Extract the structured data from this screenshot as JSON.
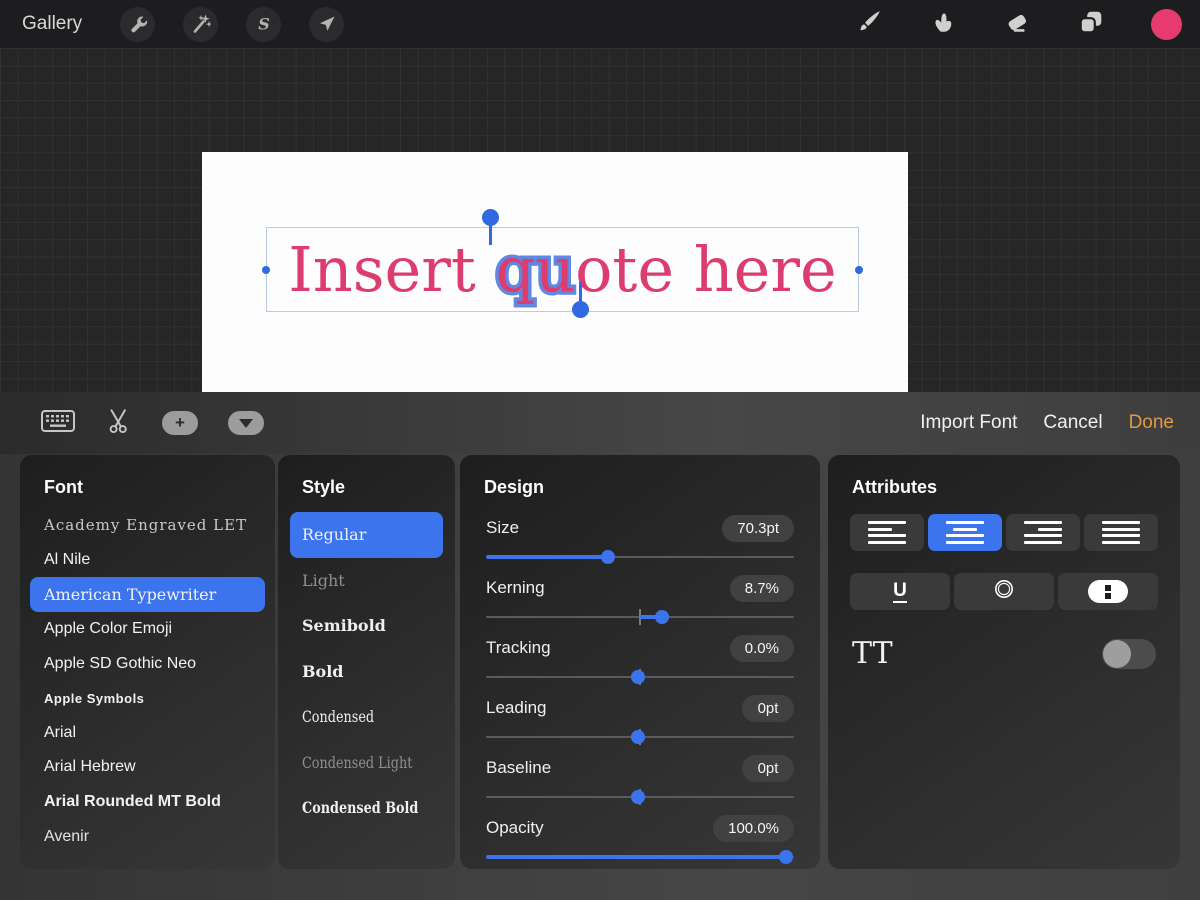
{
  "accent_color": "#3B74EC",
  "topbar": {
    "gallery_label": "Gallery",
    "left_tools": [
      "actions-wrench",
      "adjustments-wand",
      "selection-s",
      "transform-arrow"
    ],
    "right_tools": [
      "brush",
      "smudge",
      "eraser",
      "layers"
    ],
    "color_swatch_color": "#E73B6F"
  },
  "canvas": {
    "text_before": "Insert ",
    "text_selected": "qu",
    "text_after": "ote here",
    "text_color": "#DC3C6E",
    "selection_outline_color": "#6287E0"
  },
  "text_toolbar": {
    "left_tools": [
      "keyboard",
      "scissors",
      "add",
      "collapse"
    ],
    "import_font_label": "Import Font",
    "cancel_label": "Cancel",
    "done_label": "Done",
    "done_color": "#E09A40"
  },
  "font_panel": {
    "title": "Font",
    "items": [
      {
        "label": "Academy Engraved LET",
        "style": "engraved",
        "selected": false
      },
      {
        "label": "Al Nile",
        "style": "sans",
        "selected": false
      },
      {
        "label": "American Typewriter",
        "style": "typewriter",
        "selected": true
      },
      {
        "label": "Apple Color Emoji",
        "style": "sans",
        "selected": false
      },
      {
        "label": "Apple SD Gothic Neo",
        "style": "sans",
        "selected": false
      },
      {
        "label": "Apple Symbols",
        "style": "sans-sm",
        "selected": false
      },
      {
        "label": "Arial",
        "style": "sans",
        "selected": false
      },
      {
        "label": "Arial Hebrew",
        "style": "sans",
        "selected": false
      },
      {
        "label": "Arial Rounded MT Bold",
        "style": "sans-bold",
        "selected": false
      },
      {
        "label": "Avenir",
        "style": "avenir",
        "selected": false
      }
    ]
  },
  "style_panel": {
    "title": "Style",
    "items": [
      {
        "label": "Regular",
        "style": "regular",
        "selected": true
      },
      {
        "label": "Light",
        "style": "light",
        "selected": false
      },
      {
        "label": "Semibold",
        "style": "semibold",
        "selected": false
      },
      {
        "label": "Bold",
        "style": "bold",
        "selected": false
      },
      {
        "label": "Condensed",
        "style": "cond",
        "selected": false
      },
      {
        "label": "Condensed Light",
        "style": "cond-light",
        "selected": false
      },
      {
        "label": "Condensed Bold",
        "style": "cond-bold",
        "selected": false
      }
    ]
  },
  "design_panel": {
    "title": "Design",
    "rows": [
      {
        "label": "Size",
        "value": "70.3pt",
        "knob": 0.397,
        "fill_from": 0,
        "center_tick": false
      },
      {
        "label": "Kerning",
        "value": "8.7%",
        "knob": 0.57,
        "fill_from": 0.5,
        "center_tick": true
      },
      {
        "label": "Tracking",
        "value": "0.0%",
        "knob": 0.495,
        "fill_from": null,
        "center_tick": true
      },
      {
        "label": "Leading",
        "value": "0pt",
        "knob": 0.495,
        "fill_from": null,
        "center_tick": true
      },
      {
        "label": "Baseline",
        "value": "0pt",
        "knob": 0.495,
        "fill_from": null,
        "center_tick": true
      },
      {
        "label": "Opacity",
        "value": "100.0%",
        "knob": 0.973,
        "fill_from": 0,
        "center_tick": false
      }
    ]
  },
  "attributes_panel": {
    "title": "Attributes",
    "alignment_options": [
      "align-left",
      "align-center",
      "align-right",
      "justify"
    ],
    "alignment_selected_index": 1,
    "style_buttons": [
      "underline",
      "outline",
      "vertical-text"
    ],
    "underline_glyph": "U",
    "tt_label": "TT",
    "tt_toggle_on": false
  }
}
